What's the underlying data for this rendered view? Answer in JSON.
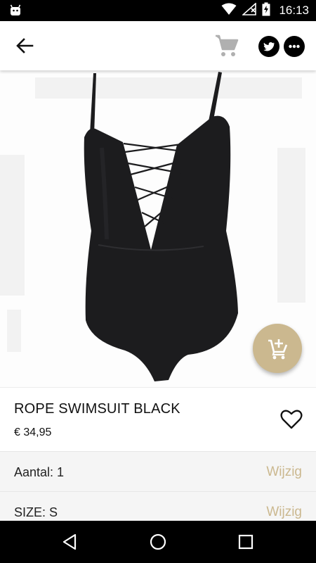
{
  "status_bar": {
    "time": "16:13"
  },
  "toolbar": {
    "back_icon": "arrow-back-icon",
    "cart_icon": "shopping-cart-icon",
    "share_icons": [
      "twitter-icon",
      "more-icon"
    ]
  },
  "product": {
    "name": "ROPE SWIMSUIT BLACK",
    "price": "€ 34,95",
    "image": "black one-piece swimsuit with lace-up front"
  },
  "options": [
    {
      "label": "Aantal: 1",
      "action": "Wijzig"
    },
    {
      "label": "SIZE: S",
      "action": "Wijzig"
    }
  ],
  "colors": {
    "accent": "#cbb88f",
    "statusbar": "#000000",
    "navbar": "#000000"
  }
}
